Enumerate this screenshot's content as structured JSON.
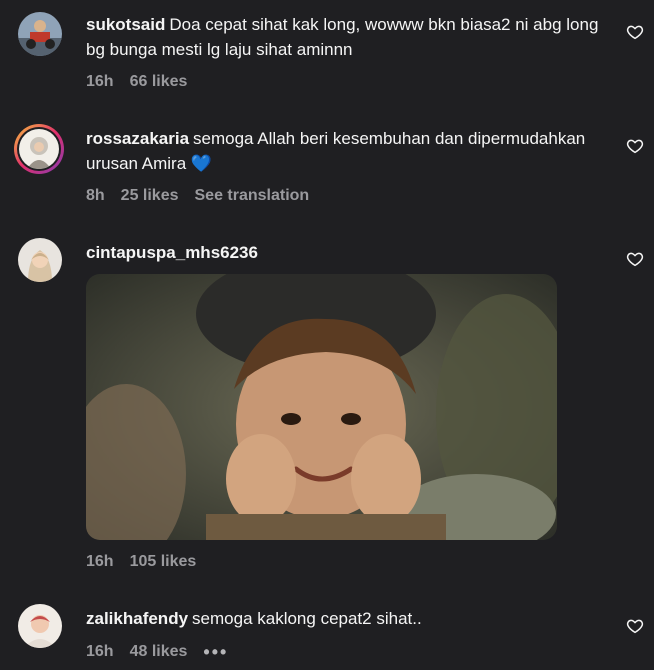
{
  "comments": [
    {
      "username": "sukotsaid",
      "text": "Doa cepat sihat kak long, wowww bkn biasa2 ni abg long bg bunga mesti lg laju sihat aminnn",
      "time": "16h",
      "likes": "66 likes"
    },
    {
      "username": "rossazakaria",
      "text": "semoga Allah beri kesembuhan dan dipermudahkan urusan Amira 💙",
      "time": "8h",
      "likes": "25 likes",
      "translation": "See translation"
    },
    {
      "username": "cintapuspa_mhs6236",
      "text": "",
      "time": "16h",
      "likes": "105 likes"
    },
    {
      "username": "zalikhafendy",
      "text": "semoga kaklong cepat2 sihat..",
      "time": "16h",
      "likes": "48 likes",
      "more": "•••"
    }
  ],
  "icons": {
    "like": "heart-outline-icon",
    "more": "more-options-icon"
  },
  "colors": {
    "background": "#1f1f22",
    "text": "#f5f5f5",
    "muted": "#9a9a9e"
  }
}
